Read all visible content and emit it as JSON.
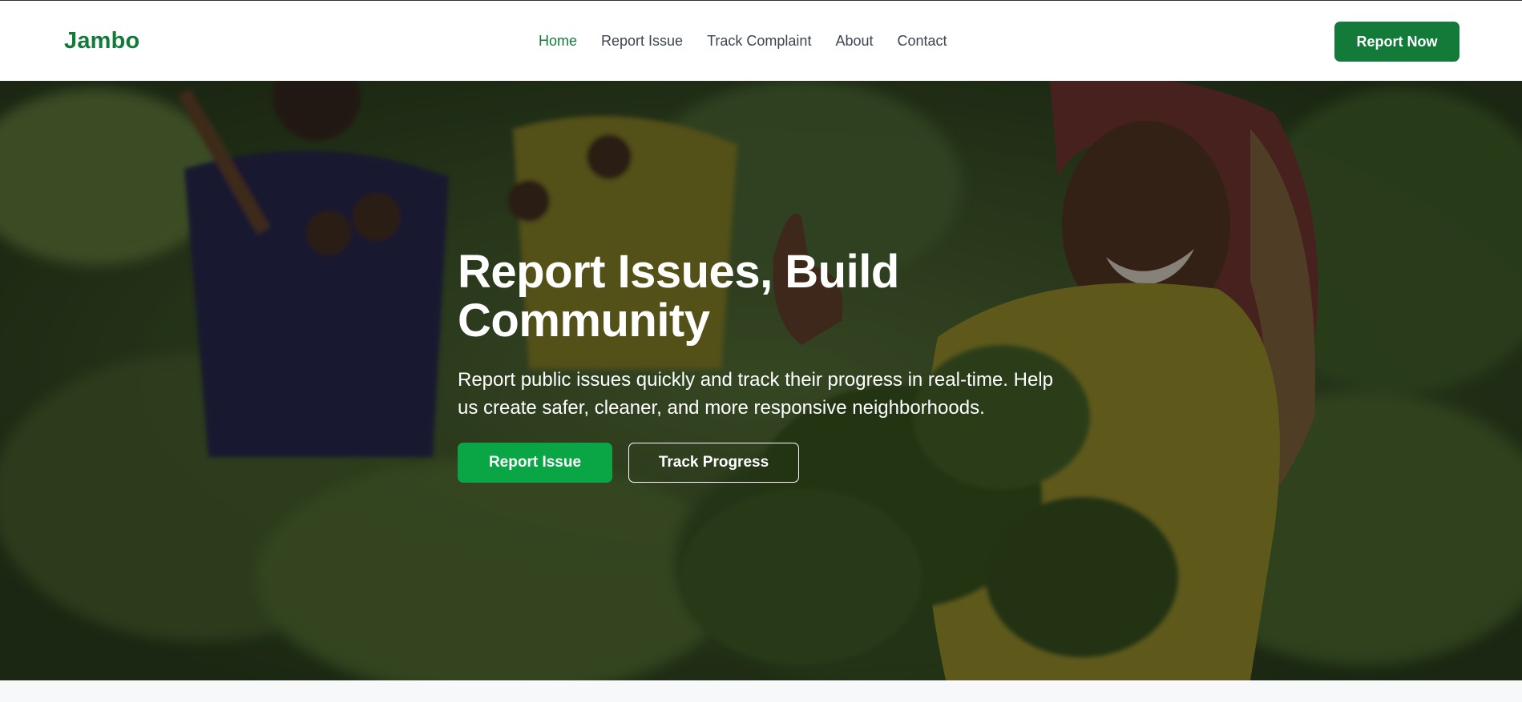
{
  "header": {
    "brand": "Jambo",
    "nav": [
      {
        "label": "Home",
        "active": true
      },
      {
        "label": "Report Issue",
        "active": false
      },
      {
        "label": "Track Complaint",
        "active": false
      },
      {
        "label": "About",
        "active": false
      },
      {
        "label": "Contact",
        "active": false
      }
    ],
    "cta_label": "Report Now"
  },
  "hero": {
    "title": "Report Issues, Build Community",
    "subtitle": "Report public issues quickly and track their progress in real-time. Help us create safer, cleaner, and more responsive neighborhoods.",
    "primary_button": "Report Issue",
    "secondary_button": "Track Progress",
    "background_image": "farmers-in-cassava-field-photo"
  },
  "colors": {
    "brand": "#137a3a",
    "primary_button": "#0aa645",
    "nav_text": "#3c4450"
  }
}
